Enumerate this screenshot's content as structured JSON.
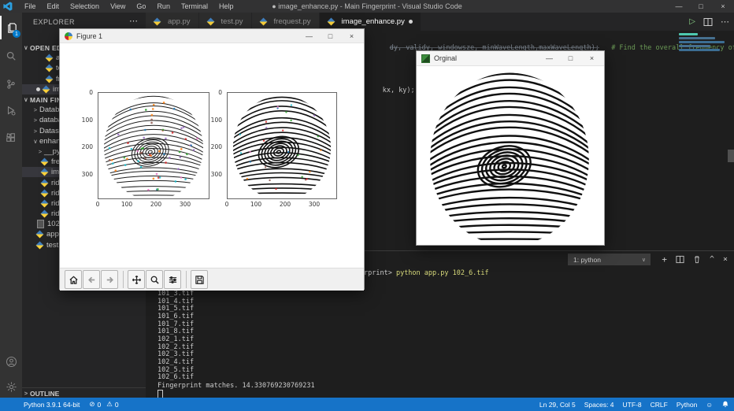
{
  "colors": {
    "status_bar": "#1673c8",
    "activity_badge": "#007acc",
    "run_button": "#89d185",
    "terminal_command_yellow": "#d7d97a",
    "comment_green": "#6a9955",
    "tab_active_bg": "#1e1e1e"
  },
  "icons": {
    "vscode-logo-icon": "blue folded ribbon",
    "files-icon": "overlapping pages",
    "search-icon": "magnifier",
    "source-control-icon": "branch",
    "run-debug-icon": "play with bug",
    "extensions-icon": "four squares",
    "account-icon": "person in circle",
    "settings-gear-icon": "gear",
    "python-file-icon": "blue-yellow diamond",
    "matplotlib-icon": "color wheel",
    "opencv-icon": "green square",
    "error-icon": "circle slash",
    "warning-icon": "triangle"
  },
  "title_bar": {
    "menus": [
      "File",
      "Edit",
      "Selection",
      "View",
      "Go",
      "Run",
      "Terminal",
      "Help"
    ],
    "modified_dot": "●",
    "title": "image_enhance.py - Main Fingerprint - Visual Studio Code",
    "controls": {
      "minimize": "—",
      "maximize": "□",
      "close": "×"
    }
  },
  "activity_bar": {
    "explorer_badge": "1"
  },
  "sidebar": {
    "title": "EXPLORER",
    "more_actions": "⋯",
    "open_editors": {
      "label": "OPEN EDITORS",
      "items": [
        {
          "label": "app.py"
        },
        {
          "label": "test.py"
        },
        {
          "label": "frequest.py"
        },
        {
          "label": "image_enhance.py",
          "modified": "●"
        }
      ]
    },
    "project": {
      "label": "MAIN FINGERPRINT",
      "tree": [
        {
          "label": "Database"
        },
        {
          "label": "database"
        },
        {
          "label": "Dataset"
        },
        {
          "label": "enhance"
        },
        {
          "label": "__pycache__"
        },
        {
          "label": "frequest.py"
        },
        {
          "label": "image_enhance.py"
        },
        {
          "label": "ridge_filter.py"
        },
        {
          "label": "ridge_freq.py"
        },
        {
          "label": "ridge_orient.py"
        },
        {
          "label": "ridge_segment.py"
        },
        {
          "label": "102_6.tif"
        },
        {
          "label": "app.py"
        },
        {
          "label": "test.py"
        }
      ]
    },
    "outline_label": "OUTLINE"
  },
  "tabs": [
    {
      "label": "app.py"
    },
    {
      "label": "test.py"
    },
    {
      "label": "frequest.py"
    },
    {
      "label": "image_enhance.py",
      "modified": "●"
    }
  ],
  "editor": {
    "top_code": "dy, validy, windowsze, minWaveLength,maxWaveLength);",
    "top_comment": "# Find the overall frequency of",
    "code_fragment": "kx, ky);"
  },
  "figure_window": {
    "title": "Figure 1",
    "controls": {
      "minimize": "—",
      "maximize": "□",
      "close": "×"
    },
    "plots": [
      {
        "yticks": [
          "0",
          "100",
          "200",
          "300"
        ],
        "xticks": [
          "0",
          "100",
          "200",
          "300"
        ]
      },
      {
        "yticks": [
          "0",
          "100",
          "200",
          "300"
        ],
        "xticks": [
          "0",
          "100",
          "200",
          "300"
        ]
      }
    ]
  },
  "original_window": {
    "title": "Orginal",
    "controls": {
      "minimize": "—",
      "maximize": "□",
      "close": "×"
    }
  },
  "terminal": {
    "selector": "1: python",
    "prompt_tail": "rprint> ",
    "command": "python app.py 102_6.tif",
    "output_lines": [
      "101_3.tif",
      "101_4.tif",
      "101_5.tif",
      "101_6.tif",
      "101_7.tif",
      "101_8.tif",
      "102_1.tif",
      "102_2.tif",
      "102_3.tif",
      "102_4.tif",
      "102_5.tif",
      "102_6.tif"
    ],
    "result": "Fingerprint matches. 14.330769230769231"
  },
  "status_bar": {
    "python_version": "Python 3.9.1 64-bit",
    "errors": "0",
    "warnings": "0",
    "cursor": "Ln 29, Col 5",
    "indent": "Spaces: 4",
    "encoding": "UTF-8",
    "eol": "CRLF",
    "language": "Python"
  },
  "chart_data": [
    {
      "type": "image",
      "subplot": "left",
      "description": "Enhanced fingerprint image (102_6.tif) with colored minutiae markers overlaid",
      "xticks": [
        0,
        100,
        200,
        300
      ],
      "yticks": [
        0,
        100,
        200,
        300
      ],
      "xlim": [
        0,
        380
      ],
      "ylim": [
        380,
        0
      ],
      "grid": false
    },
    {
      "type": "image",
      "subplot": "right",
      "description": "Binarized/thinned fingerprint ridge skeleton with sparse colored minutiae markers",
      "xticks": [
        0,
        100,
        200,
        300
      ],
      "yticks": [
        0,
        100,
        200,
        300
      ],
      "xlim": [
        0,
        380
      ],
      "ylim": [
        380,
        0
      ],
      "grid": false
    }
  ]
}
